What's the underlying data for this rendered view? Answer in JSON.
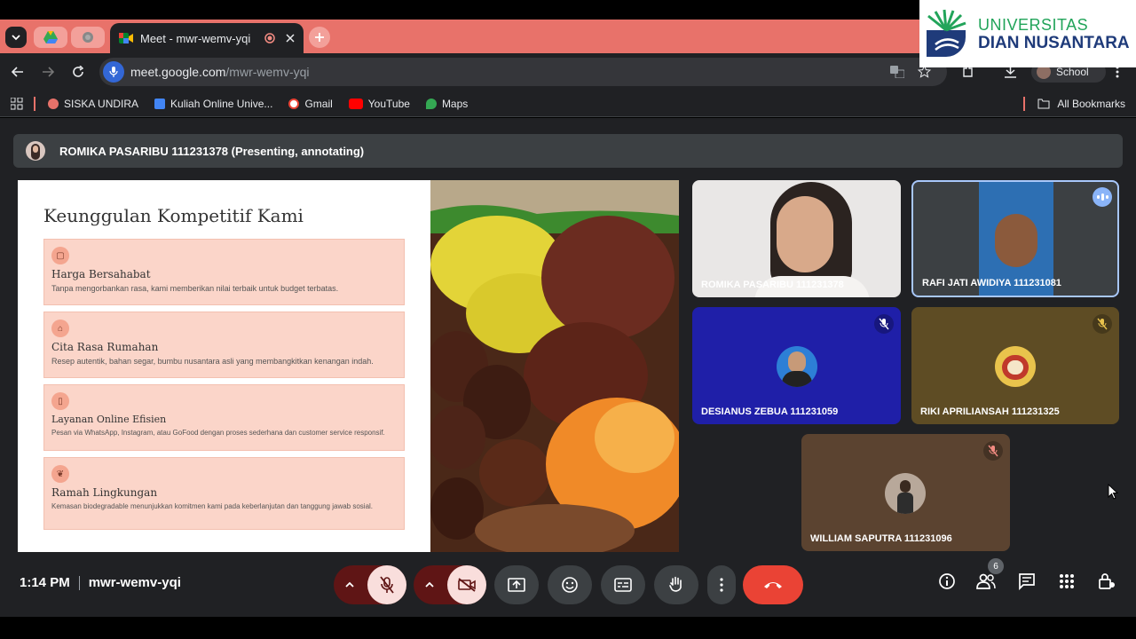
{
  "browser": {
    "active_tab_title": "Meet - mwr-wemv-yqi",
    "url_host": "meet.google.com",
    "url_path": "/mwr-wemv-yqi",
    "profile_label": "School",
    "bookmarks": [
      "SISKA UNDIRA",
      "Kuliah Online Unive...",
      "Gmail",
      "YouTube",
      "Maps"
    ],
    "all_bookmarks": "All Bookmarks"
  },
  "logo": {
    "line1": "UNIVERSITAS",
    "line2": "DIAN NUSANTARA"
  },
  "meet": {
    "presenter_label": "ROMIKA PASARIBU 111231378 (Presenting, annotating)",
    "time": "1:14 PM",
    "meeting_code": "mwr-wemv-yqi",
    "people_count": "6"
  },
  "slide": {
    "title": "Keunggulan Kompetitif Kami",
    "cards": [
      {
        "title": "Harga Bersahabat",
        "desc": "Tanpa mengorbankan rasa, kami memberikan nilai terbaik untuk budget terbatas."
      },
      {
        "title": "Cita Rasa Rumahan",
        "desc": "Resep autentik, bahan segar, bumbu nusantara asli yang membangkitkan kenangan indah."
      },
      {
        "title": "Layanan Online Efisien",
        "desc": "Pesan via WhatsApp, Instagram, atau GoFood dengan proses sederhana dan customer service responsif."
      },
      {
        "title": "Ramah Lingkungan",
        "desc": "Kemasan biodegradable menunjukkan komitmen kami pada keberlanjutan dan tanggung jawab sosial."
      }
    ]
  },
  "participants": [
    {
      "name": "ROMIKA PASARIBU 111231378",
      "bg": "#e9e7e6"
    },
    {
      "name": "RAFI JATI AWIDIYA 111231081",
      "bg": "#3c4043"
    },
    {
      "name": "DESIANUS ZEBUA 111231059",
      "bg": "#1f1fa8"
    },
    {
      "name": "RIKI APRILIANSAH 111231325",
      "bg": "#5e4c24"
    },
    {
      "name": "WILLIAM SAPUTRA 111231096",
      "bg": "#5b4330"
    }
  ],
  "colors": {
    "accent_blue": "#8ab4f8",
    "end_call": "#ea4335",
    "mic_off": "#5f1515",
    "tab_strip": "#e8726a"
  }
}
